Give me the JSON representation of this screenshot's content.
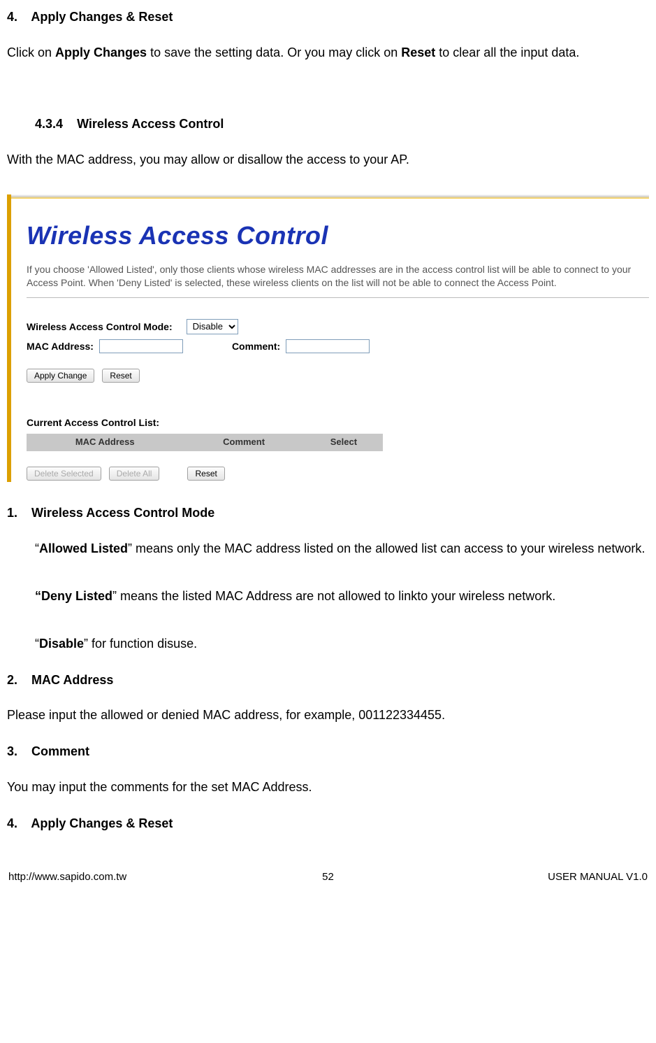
{
  "section4": {
    "number": "4.",
    "title": "Apply Changes & Reset",
    "text_pre": "Click on ",
    "text_apply": "Apply Changes",
    "text_mid": " to save the setting data. Or you may click on ",
    "text_reset": "Reset",
    "text_post": " to clear all the input data."
  },
  "section434": {
    "number": "4.3.4",
    "title": "Wireless Access Control",
    "intro": "With the MAC address, you may allow or disallow the access to your AP."
  },
  "screenshot": {
    "title": "Wireless Access Control",
    "desc": "If you choose 'Allowed Listed', only those clients whose wireless MAC addresses are in the access control list will be able to connect to your Access Point. When 'Deny Listed' is selected, these wireless clients on the list will not be able to connect the Access Point.",
    "mode_label": "Wireless Access Control Mode:",
    "mode_value": "Disable",
    "mac_label": "MAC Address:",
    "mac_value": "",
    "comment_label": "Comment:",
    "comment_value": "",
    "apply_btn": "Apply Change",
    "reset_btn": "Reset",
    "list_heading": "Current Access Control List:",
    "table": {
      "col1": "MAC Address",
      "col2": "Comment",
      "col3": "Select"
    },
    "delete_selected_btn": "Delete Selected",
    "delete_all_btn": "Delete All",
    "reset2_btn": "Reset"
  },
  "item1": {
    "number": "1.",
    "title": "Wireless Access Control Mode",
    "allowed_q1": "“",
    "allowed_b": "Allowed Listed",
    "allowed_rest": "” means only the MAC address listed on the allowed list can access to your wireless network.",
    "deny_q1": "“",
    "deny_b": "Deny Listed",
    "deny_rest": "” means the listed MAC Address are not allowed to linkto your wireless network.",
    "disable_q1": "“",
    "disable_b": "Disable",
    "disable_rest": "” for function disuse."
  },
  "item2": {
    "number": "2.",
    "title": "MAC Address",
    "text": "Please input the allowed or denied MAC address, for example, 001122334455."
  },
  "item3": {
    "number": "3.",
    "title": "Comment",
    "text": "You may input the comments for the set MAC Address."
  },
  "item4": {
    "number": "4.",
    "title": "Apply Changes & Reset"
  },
  "footer": {
    "url": "http://www.sapido.com.tw",
    "page": "52",
    "manual": "USER MANUAL V1.0"
  }
}
